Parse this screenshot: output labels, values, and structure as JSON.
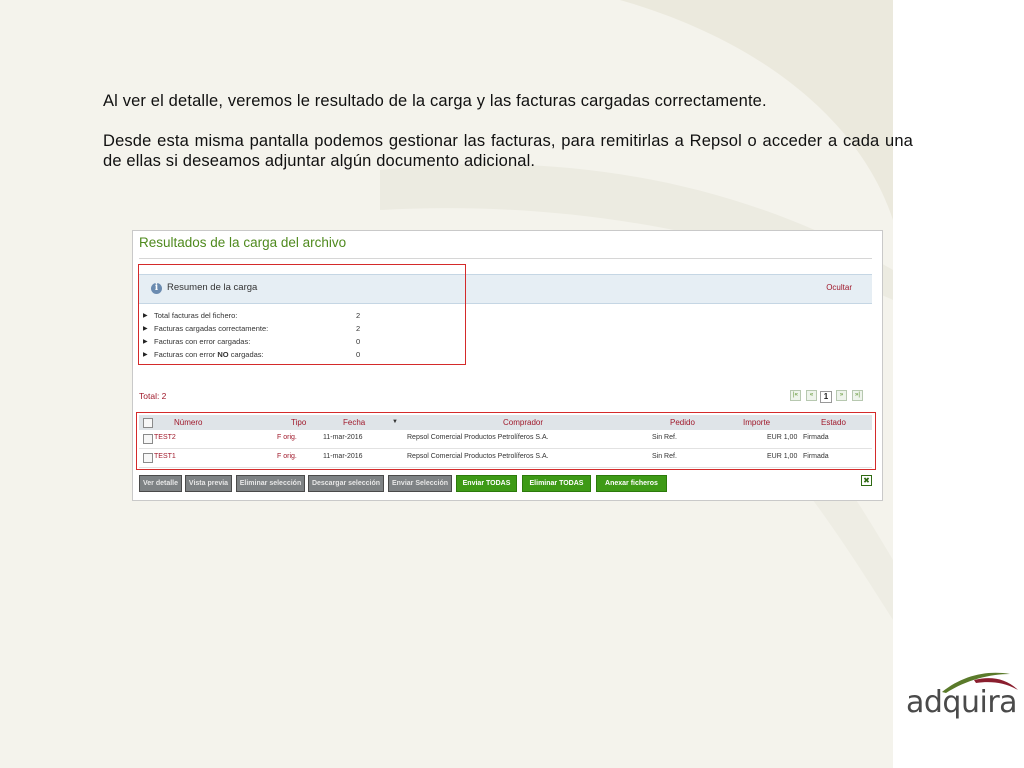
{
  "slide": {
    "para1": "Al ver el detalle, veremos le resultado de la carga y las facturas cargadas correctamente.",
    "para2": "Desde esta misma pantalla podemos gestionar las facturas, para remitirlas a Repsol o acceder a cada una de ellas si deseamos adjuntar algún documento adicional."
  },
  "panel": {
    "title": "Resultados de la carga del archivo",
    "summary": {
      "title": "Resumen de la carga",
      "hide_label": "Ocultar",
      "items": [
        {
          "label": "Total facturas del fichero:",
          "value": "2"
        },
        {
          "label": "Facturas cargadas correctamente:",
          "value": "2"
        },
        {
          "label": "Facturas con error cargadas:",
          "value": "0"
        },
        {
          "label_pre": "Facturas con error ",
          "label_bold": "NO",
          "label_post": " cargadas:",
          "value": "0"
        }
      ]
    },
    "total_label": "Total: 2",
    "pager": {
      "first": "|«",
      "prev": "«",
      "page": "1",
      "next": "»",
      "last": "»|"
    },
    "table": {
      "headers": {
        "numero": "Número",
        "tipo": "Tipo",
        "fecha": "Fecha",
        "sort": "▼",
        "comprador": "Comprador",
        "pedido": "Pedido",
        "importe": "Importe",
        "estado": "Estado"
      },
      "rows": [
        {
          "numero": "TEST2",
          "tipo": "F orig.",
          "fecha": "11-mar-2016",
          "comprador": "Repsol Comercial Productos Petrolíferos S.A.",
          "pedido": "Sin Ref.",
          "importe": "EUR 1,00",
          "estado": "Firmada"
        },
        {
          "numero": "TEST1",
          "tipo": "F orig.",
          "fecha": "11-mar-2016",
          "comprador": "Repsol Comercial Productos Petrolíferos S.A.",
          "pedido": "Sin Ref.",
          "importe": "EUR 1,00",
          "estado": "Firmada"
        }
      ]
    },
    "buttons": {
      "ver_detalle": "Ver detalle",
      "vista_previa": "Vista previa",
      "eliminar_seleccion": "Eliminar selección",
      "descargar_seleccion": "Descargar selección",
      "enviar_seleccion": "Enviar Selección",
      "enviar_todas": "Enviar TODAS",
      "eliminar_todas": "Eliminar TODAS",
      "anexar_ficheros": "Anexar ficheros"
    },
    "close_glyph": "✖"
  },
  "logo": {
    "text": "adquira"
  },
  "colors": {
    "accent_green": "#4f8a1e",
    "accent_red": "#a0192b",
    "highlight_red": "#d42a2a",
    "button_green": "#3e9a16"
  }
}
